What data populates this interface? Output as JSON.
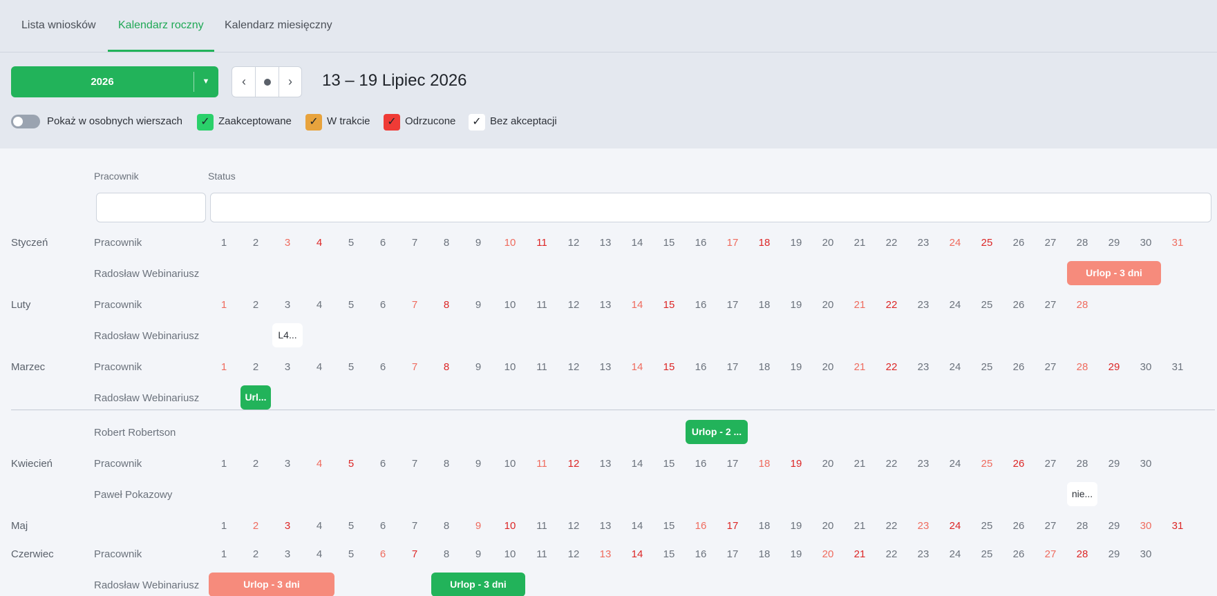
{
  "tabs": [
    "Lista wniosków",
    "Kalendarz roczny",
    "Kalendarz miesięczny"
  ],
  "toolbar": {
    "year": "2026",
    "range_title": "13 – 19 Lipiec 2026"
  },
  "filters": {
    "separate_rows_label": "Pokaż w osobnych wierszach",
    "accepted_label": "Zaakceptowane",
    "in_progress_label": "W trakcie",
    "rejected_label": "Odrzucone",
    "no_acceptance_label": "Bez akceptacji",
    "colors": {
      "accepted": "#2ad06a",
      "in_progress": "#e8a33d",
      "rejected": "#ef3b36",
      "no_acceptance": "#ffffff"
    }
  },
  "table": {
    "employee_header": "Pracownik",
    "status_header": "Status"
  },
  "months": [
    {
      "name": "Styczeń",
      "header": "Pracownik",
      "days": 31,
      "sat": [
        3,
        10,
        17,
        24,
        31
      ],
      "sun": [
        4,
        11,
        18,
        25
      ],
      "rows": [
        {
          "name": "Radosław Webinariusz",
          "events": [
            {
              "label": "Urlop - 3 dni",
              "color": "salmon",
              "start": 28,
              "end": 30
            }
          ]
        }
      ]
    },
    {
      "name": "Luty",
      "header": "Pracownik",
      "days": 28,
      "sat": [
        1,
        7,
        14,
        21,
        28
      ],
      "sun": [
        8,
        15,
        22
      ],
      "rows": [
        {
          "name": "Radosław Webinariusz",
          "events": [
            {
              "label": "L4...",
              "color": "white",
              "start": 3,
              "end": 3
            }
          ]
        }
      ]
    },
    {
      "name": "Marzec",
      "header": "Pracownik",
      "days": 31,
      "sat": [
        1,
        7,
        14,
        21,
        28
      ],
      "sun": [
        8,
        15,
        22,
        29
      ],
      "rows": [
        {
          "name": "Radosław Webinariusz",
          "events": [
            {
              "label": "Url...",
              "color": "green",
              "start": 2,
              "end": 2
            }
          ]
        }
      ]
    },
    {
      "name": "",
      "header": "",
      "days": 0,
      "sat": [],
      "sun": [],
      "rows": [
        {
          "name": "Robert Robertson",
          "events": [
            {
              "label": "Urlop - 2 ...",
              "color": "green",
              "start": 16,
              "end": 17
            }
          ]
        }
      ]
    },
    {
      "name": "Kwiecień",
      "header": "Pracownik",
      "days": 30,
      "sat": [
        4,
        11,
        18,
        25
      ],
      "sun": [
        5,
        12,
        19,
        26
      ],
      "rows": [
        {
          "name": "Paweł Pokazowy",
          "events": [
            {
              "label": "nie...",
              "color": "white",
              "start": 28,
              "end": 28
            }
          ]
        }
      ]
    },
    {
      "name": "Maj",
      "header": "",
      "days": 31,
      "sat": [
        2,
        9,
        16,
        23,
        30
      ],
      "sun": [
        3,
        10,
        17,
        24,
        31
      ],
      "rows": []
    },
    {
      "name": "Czerwiec",
      "header": "Pracownik",
      "days": 30,
      "sat": [
        6,
        13,
        20,
        27
      ],
      "sun": [
        7,
        14,
        21,
        28
      ],
      "rows": [
        {
          "name": "Radosław Webinariusz",
          "events": [
            {
              "label": "Urlop - 3 dni",
              "color": "salmon",
              "start": 1,
              "end": 4
            },
            {
              "label": "Urlop - 3 dni",
              "color": "green",
              "start": 8,
              "end": 10
            }
          ]
        }
      ]
    }
  ]
}
